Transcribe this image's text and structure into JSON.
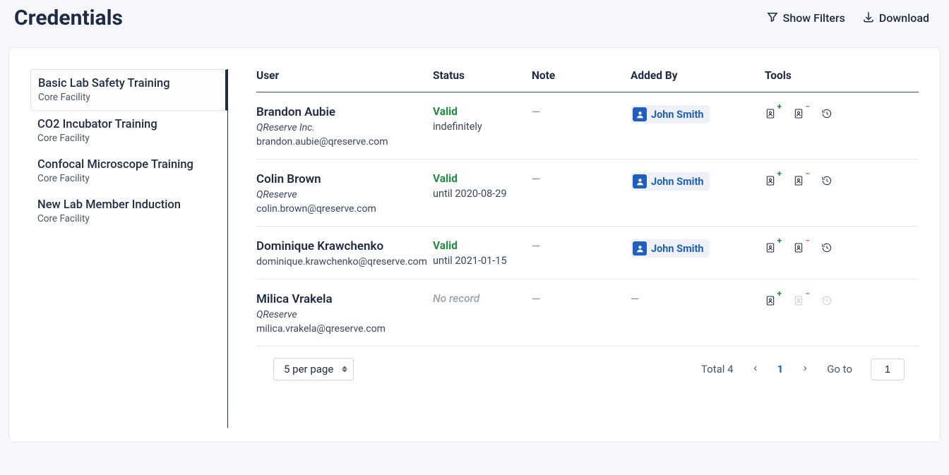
{
  "header": {
    "title": "Credentials",
    "show_filters_label": "Show Filters",
    "download_label": "Download"
  },
  "sidebar": {
    "items": [
      {
        "title": "Basic Lab Safety Training",
        "subtitle": "Core Facility",
        "active": true
      },
      {
        "title": "CO2 Incubator Training",
        "subtitle": "Core Facility",
        "active": false
      },
      {
        "title": "Confocal Microscope Training",
        "subtitle": "Core Facility",
        "active": false
      },
      {
        "title": "New Lab Member Induction",
        "subtitle": "Core Facility",
        "active": false
      }
    ]
  },
  "table": {
    "columns": {
      "user": "User",
      "status": "Status",
      "note": "Note",
      "added_by": "Added By",
      "tools": "Tools"
    },
    "rows": [
      {
        "user": {
          "name": "Brandon Aubie",
          "org": "QReserve Inc.",
          "email": "brandon.aubie@qreserve.com"
        },
        "status": {
          "kind": "valid",
          "label": "Valid",
          "sub": "indefinitely"
        },
        "note": "—",
        "added_by": "John Smith",
        "tools_disabled": false
      },
      {
        "user": {
          "name": "Colin Brown",
          "org": "QReserve",
          "email": "colin.brown@qreserve.com"
        },
        "status": {
          "kind": "valid",
          "label": "Valid",
          "sub": "until 2020-08-29"
        },
        "note": "—",
        "added_by": "John Smith",
        "tools_disabled": false
      },
      {
        "user": {
          "name": "Dominique Krawchenko",
          "org": "",
          "email": "dominique.krawchenko@qreserve.com"
        },
        "status": {
          "kind": "valid",
          "label": "Valid",
          "sub": "until 2021-01-15"
        },
        "note": "—",
        "added_by": "John Smith",
        "tools_disabled": false
      },
      {
        "user": {
          "name": "Milica Vrakela",
          "org": "QReserve",
          "email": "milica.vrakela@qreserve.com"
        },
        "status": {
          "kind": "norecord",
          "label": "No record",
          "sub": ""
        },
        "note": "—",
        "added_by": "—",
        "tools_disabled": true
      }
    ]
  },
  "pagination": {
    "per_page_label": "5 per page",
    "total_prefix": "Total",
    "total_count": "4",
    "current_page": "1",
    "go_to_label": "Go to",
    "go_to_value": "1"
  }
}
